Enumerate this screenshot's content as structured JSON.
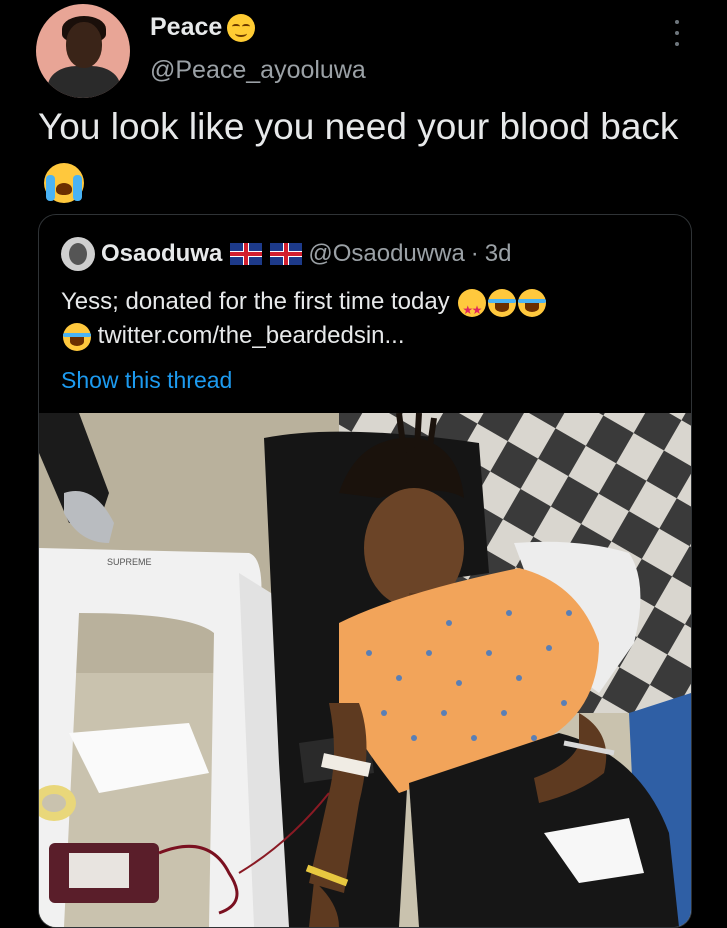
{
  "author": {
    "name": "Peace",
    "handle": "@Peace_ayooluwa",
    "name_emoji": "relieved-face-emoji"
  },
  "tweet": {
    "text": "You look like you need your blood back",
    "emoji": "loudly-crying-face-emoji"
  },
  "quoted_tweet": {
    "name": "Osaoduwa",
    "flags": [
      "uk-flag-icon",
      "uk-flag-icon"
    ],
    "handle": "@Osaoduwwa",
    "separator": "·",
    "time": "3d",
    "text": "Yess; donated for the first time today",
    "link": "twitter.com/the_beardedsin...",
    "emojis": [
      "star-struck-emoji",
      "tears-of-joy-emoji",
      "tears-of-joy-emoji",
      "tears-of-joy-emoji"
    ],
    "show_thread": "Show this thread",
    "photo_label": "A young woman in an orange blouse reclining on a black chair while donating blood, with a blood bag on a white chair beside her",
    "chair_label": "SUPREME"
  },
  "colors": {
    "background": "#000000",
    "text": "#e7e9ea",
    "secondary": "#9ba1a6",
    "link": "#1d9bf0",
    "border": "#2f3336"
  }
}
